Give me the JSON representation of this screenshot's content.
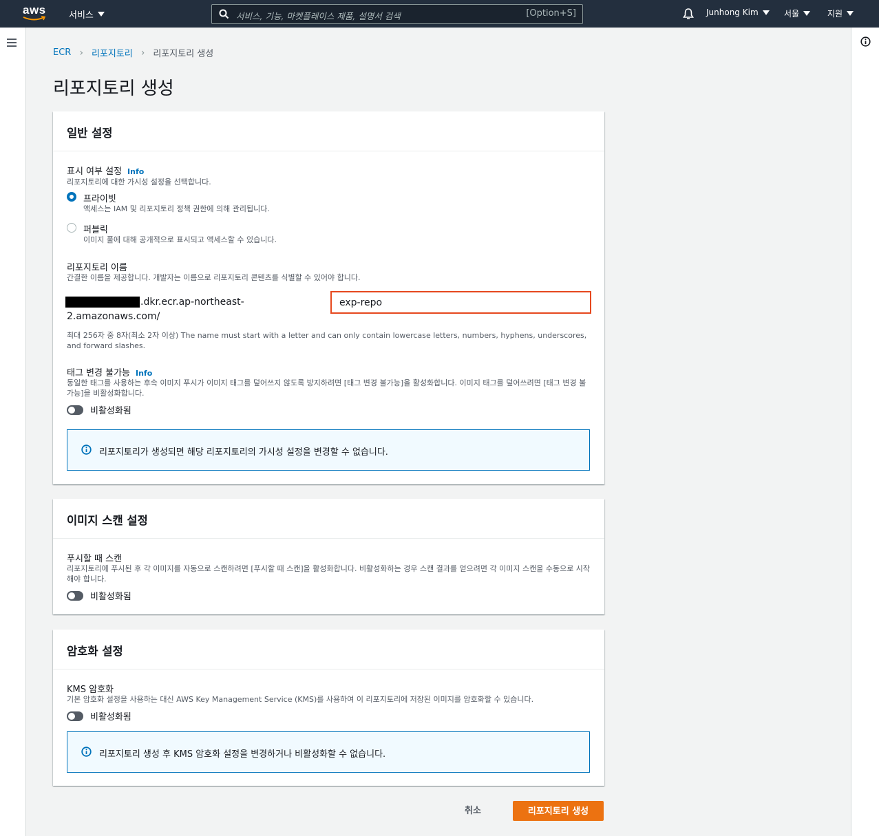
{
  "topnav": {
    "logo_text": "aws",
    "services_label": "서비스",
    "search_placeholder": "서비스, 기능, 마켓플레이스 제품, 설명서 검색",
    "search_shortcut": "[Option+S]",
    "user_name": "Junhong Kim",
    "region": "서울",
    "support": "지원"
  },
  "breadcrumb": {
    "root": "ECR",
    "parent": "리포지토리",
    "current": "리포지토리 생성"
  },
  "page_title": "리포지토리 생성",
  "general": {
    "header": "일반 설정",
    "visibility_label": "표시 여부 설정",
    "info": "Info",
    "visibility_desc": "리포지토리에 대한 가시성 설정을 선택합니다.",
    "private_label": "프라이빗",
    "private_desc": "액세스는 IAM 및 리포지토리 정책 권한에 의해 관리됩니다.",
    "public_label": "퍼블릭",
    "public_desc": "이미지 풀에 대해 공개적으로 표시되고 액세스할 수 있습니다.",
    "repo_name_label": "리포지토리 이름",
    "repo_name_desc": "간결한 이름을 제공합니다. 개발자는 이름으로 리포지토리 콘텐츠를 식별할 수 있어야 합니다.",
    "uri_line1": ".dkr.ecr.ap-northeast-",
    "uri_line2": "2.amazonaws.com/",
    "repo_name_value": "exp-repo",
    "repo_name_hint": "최대 256자 중 8자(최소 2자 이상) The name must start with a letter and can only contain lowercase letters, numbers, hyphens, underscores, and forward slashes.",
    "tag_label": "태그 변경 불가능",
    "tag_info": "Info",
    "tag_desc": "동일한 태그를 사용하는 후속 이미지 푸시가 이미지 태그를 덮어쓰지 않도록 방지하려면 [태그 변경 불가능]을 활성화합니다. 이미지 태그를 덮어쓰려면 [태그 변경 불가능]을 비활성화합니다.",
    "tag_toggle": "비활성화됨",
    "alert": "리포지토리가 생성되면 해당 리포지토리의 가시성 설정을 변경할 수 없습니다."
  },
  "scan": {
    "header": "이미지 스캔 설정",
    "label": "푸시할 때 스캔",
    "desc": "리포지토리에 푸시된 후 각 이미지를 자동으로 스캔하려면 [푸시할 때 스캔]을 활성화합니다. 비활성화하는 경우 스캔 결과를 얻으려면 각 이미지 스캔을 수동으로 시작해야 합니다.",
    "toggle": "비활성화됨"
  },
  "encryption": {
    "header": "암호화 설정",
    "label": "KMS 암호화",
    "desc": "기본 암호화 설정을 사용하는 대신 AWS Key Management Service (KMS)를 사용하여 이 리포지토리에 저장된 이미지를 암호화할 수 있습니다.",
    "toggle": "비활성화됨",
    "alert": "리포지토리 생성 후 KMS 암호화 설정을 변경하거나 비활성화할 수 없습니다."
  },
  "actions": {
    "cancel": "취소",
    "create": "리포지토리 생성"
  },
  "colors": {
    "nav_bg": "#232f3e",
    "link": "#0073bb",
    "primary_button": "#ec7211",
    "highlight_border": "#e6481e"
  }
}
